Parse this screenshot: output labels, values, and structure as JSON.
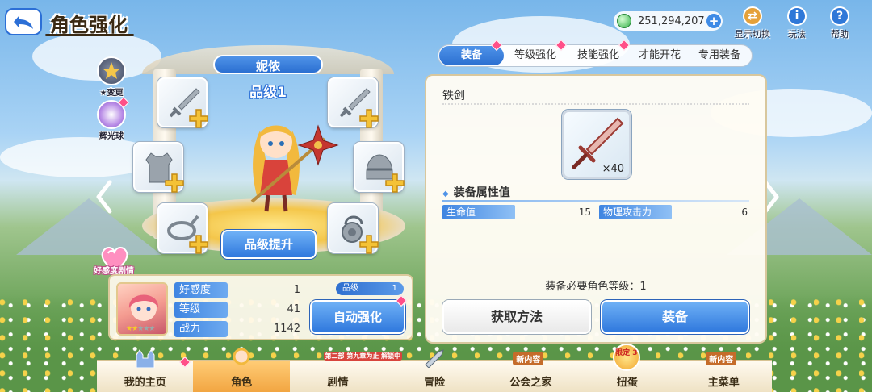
{
  "header": {
    "title": "角色强化",
    "currency_value": "251,294,207",
    "buttons": [
      {
        "label": "显示切换",
        "icon": "display-switch-icon"
      },
      {
        "label": "玩法",
        "icon": "info-icon"
      },
      {
        "label": "帮助",
        "icon": "help-icon"
      }
    ]
  },
  "left_side": {
    "change_label": "★变更",
    "orb_label": "辉光球",
    "favor_label": "好感度剧情"
  },
  "character": {
    "name": "妮侬",
    "rank_text": "品级1",
    "rank_up_label": "品级提升",
    "stats": [
      {
        "label": "好感度",
        "value": "1"
      },
      {
        "label": "等级",
        "value": "41"
      },
      {
        "label": "战力",
        "value": "1142"
      }
    ],
    "rank_chip_label": "品级",
    "rank_chip_value": "1",
    "auto_enhance_label": "自动强化",
    "stars_filled": 2,
    "stars_total": 5
  },
  "equipment_slots": [
    {
      "name": "sword-slot-1",
      "icon": "sword-icon"
    },
    {
      "name": "sword-slot-2",
      "icon": "sword-icon"
    },
    {
      "name": "armor-slot",
      "icon": "armor-icon"
    },
    {
      "name": "helmet-slot",
      "icon": "helmet-icon"
    },
    {
      "name": "rope-slot",
      "icon": "rope-icon"
    },
    {
      "name": "amulet-slot",
      "icon": "amulet-icon"
    }
  ],
  "tabs": [
    {
      "label": "装备",
      "active": true
    },
    {
      "label": "等级强化",
      "active": false
    },
    {
      "label": "技能强化",
      "active": false
    },
    {
      "label": "才能开花",
      "active": false
    },
    {
      "label": "专用装备",
      "active": false
    }
  ],
  "equipment_detail": {
    "name": "铁剑",
    "quantity": "×40",
    "attr_title": "装备属性值",
    "attributes": [
      {
        "label": "生命值",
        "value": "15"
      },
      {
        "label": "物理攻击力",
        "value": "6"
      }
    ],
    "requirement_text": "装备必要角色等级：1",
    "acquire_label": "获取方法",
    "equip_label": "装备"
  },
  "bottom_nav": [
    {
      "label": "我的主页",
      "active": false,
      "tag": ""
    },
    {
      "label": "角色",
      "active": true,
      "tag": ""
    },
    {
      "label": "剧情",
      "active": false,
      "tag": "第二部 第九章为止 解锁中"
    },
    {
      "label": "冒险",
      "active": false,
      "tag": ""
    },
    {
      "label": "公会之家",
      "active": false,
      "tag": "新内容"
    },
    {
      "label": "扭蛋",
      "active": false,
      "tag": "限定 3"
    },
    {
      "label": "主菜单",
      "active": false,
      "tag": "新内容"
    }
  ],
  "colors": {
    "accent_blue": "#2f78dd",
    "badge_pink": "#ff4f88",
    "panel_border": "#d8c79d"
  }
}
